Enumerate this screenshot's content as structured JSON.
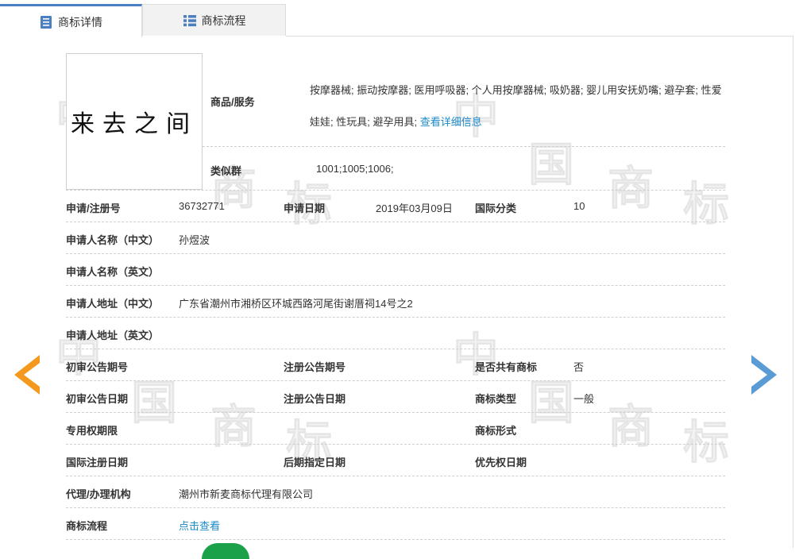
{
  "tabs": {
    "details": "商标详情",
    "flow": "商标流程"
  },
  "watermark": "中国商标",
  "logo": {
    "text": "来去之间"
  },
  "goods": {
    "label": "商品/服务",
    "text": "按摩器械; 振动按摩器; 医用呼吸器; 个人用按摩器械; 吸奶器; 婴儿用安抚奶嘴; 避孕套; 性爱娃娃; 性玩具; 避孕用具;",
    "link": "查看详细信息"
  },
  "similar_group": {
    "label": "类似群",
    "value": "1001;1005;1006;"
  },
  "fields": {
    "reg_no_label": "申请/注册号",
    "reg_no": "36732771",
    "apply_date_label": "申请日期",
    "apply_date": "2019年03月09日",
    "intl_class_label": "国际分类",
    "intl_class": "10",
    "applicant_cn_label": "申请人名称（中文）",
    "applicant_cn": "孙煜波",
    "applicant_en_label": "申请人名称（英文）",
    "applicant_en": "",
    "address_cn_label": "申请人地址（中文）",
    "address_cn": "广东省潮州市湘桥区环城西路河尾街谢厝祠14号之2",
    "address_en_label": "申请人地址（英文）",
    "address_en": "",
    "prelim_no_label": "初审公告期号",
    "prelim_no": "",
    "reg_notice_no_label": "注册公告期号",
    "reg_notice_no": "",
    "shared_label": "是否共有商标",
    "shared": "否",
    "prelim_date_label": "初审公告日期",
    "prelim_date": "",
    "reg_notice_date_label": "注册公告日期",
    "reg_notice_date": "",
    "mark_type_label": "商标类型",
    "mark_type": "一般",
    "exclusive_label": "专用权期限",
    "exclusive": "",
    "mark_form_label": "商标形式",
    "mark_form": "",
    "intl_reg_date_label": "国际注册日期",
    "intl_reg_date": "",
    "later_date_label": "后期指定日期",
    "later_date": "",
    "priority_label": "优先权日期",
    "priority": "",
    "agent_label": "代理/办理机构",
    "agent": "潮州市新麦商标代理有限公司",
    "flow_label": "商标流程",
    "flow_link": "点击查看"
  },
  "colors": {
    "accent": "#1b8ac9",
    "prev_arrow": "#f39a1e",
    "next_arrow": "#5b9bd5",
    "tab_accent": "#4a7fc1"
  },
  "icons": {
    "details_tab": "document-list-icon",
    "flow_tab": "list-icon",
    "prev": "chevron-left-icon",
    "next": "chevron-right-icon"
  }
}
